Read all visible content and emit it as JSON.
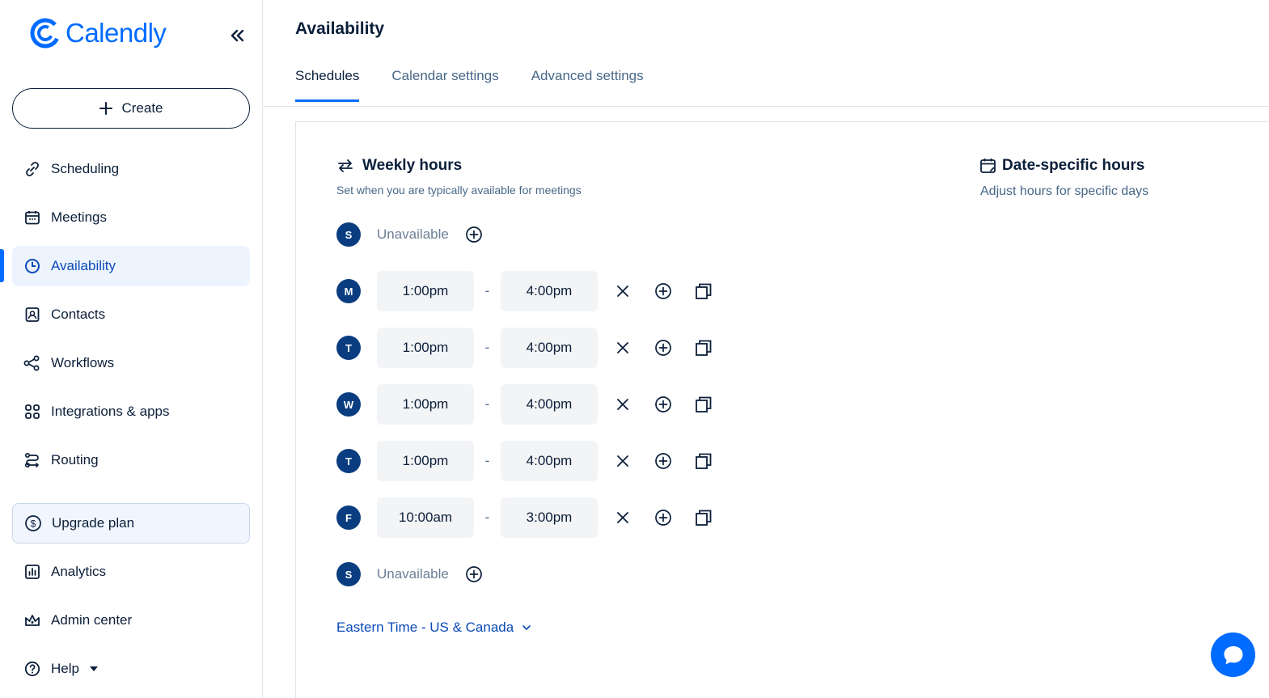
{
  "app": {
    "brand": "Calendly",
    "accent": "#006bff"
  },
  "sidebar": {
    "create_label": "Create",
    "items": [
      {
        "label": "Scheduling",
        "icon": "link-icon"
      },
      {
        "label": "Meetings",
        "icon": "calendar-icon"
      },
      {
        "label": "Availability",
        "icon": "clock-icon",
        "active": true
      },
      {
        "label": "Contacts",
        "icon": "contact-card-icon"
      },
      {
        "label": "Workflows",
        "icon": "workflow-icon"
      },
      {
        "label": "Integrations & apps",
        "icon": "apps-grid-icon"
      },
      {
        "label": "Routing",
        "icon": "routing-icon"
      },
      {
        "label": "Upgrade plan",
        "icon": "dollar-circle-icon"
      },
      {
        "label": "Analytics",
        "icon": "bar-chart-icon"
      },
      {
        "label": "Admin center",
        "icon": "crown-icon"
      },
      {
        "label": "Help",
        "icon": "help-circle-icon"
      }
    ]
  },
  "header": {
    "title": "Availability",
    "tabs": [
      {
        "label": "Schedules",
        "active": true
      },
      {
        "label": "Calendar settings"
      },
      {
        "label": "Advanced settings"
      }
    ]
  },
  "weekly": {
    "title": "Weekly hours",
    "subtitle": "Set when you are typically available for meetings",
    "unavailable_label": "Unavailable",
    "dash": "-",
    "days": [
      {
        "letter": "S",
        "available": false
      },
      {
        "letter": "M",
        "available": true,
        "start": "1:00pm",
        "end": "4:00pm"
      },
      {
        "letter": "T",
        "available": true,
        "start": "1:00pm",
        "end": "4:00pm"
      },
      {
        "letter": "W",
        "available": true,
        "start": "1:00pm",
        "end": "4:00pm"
      },
      {
        "letter": "T",
        "available": true,
        "start": "1:00pm",
        "end": "4:00pm"
      },
      {
        "letter": "F",
        "available": true,
        "start": "10:00am",
        "end": "3:00pm"
      },
      {
        "letter": "S",
        "available": false
      }
    ]
  },
  "date_specific": {
    "title": "Date-specific hours",
    "subtitle": "Adjust hours for specific days"
  },
  "timezone": {
    "label": "Eastern Time - US & Canada"
  }
}
